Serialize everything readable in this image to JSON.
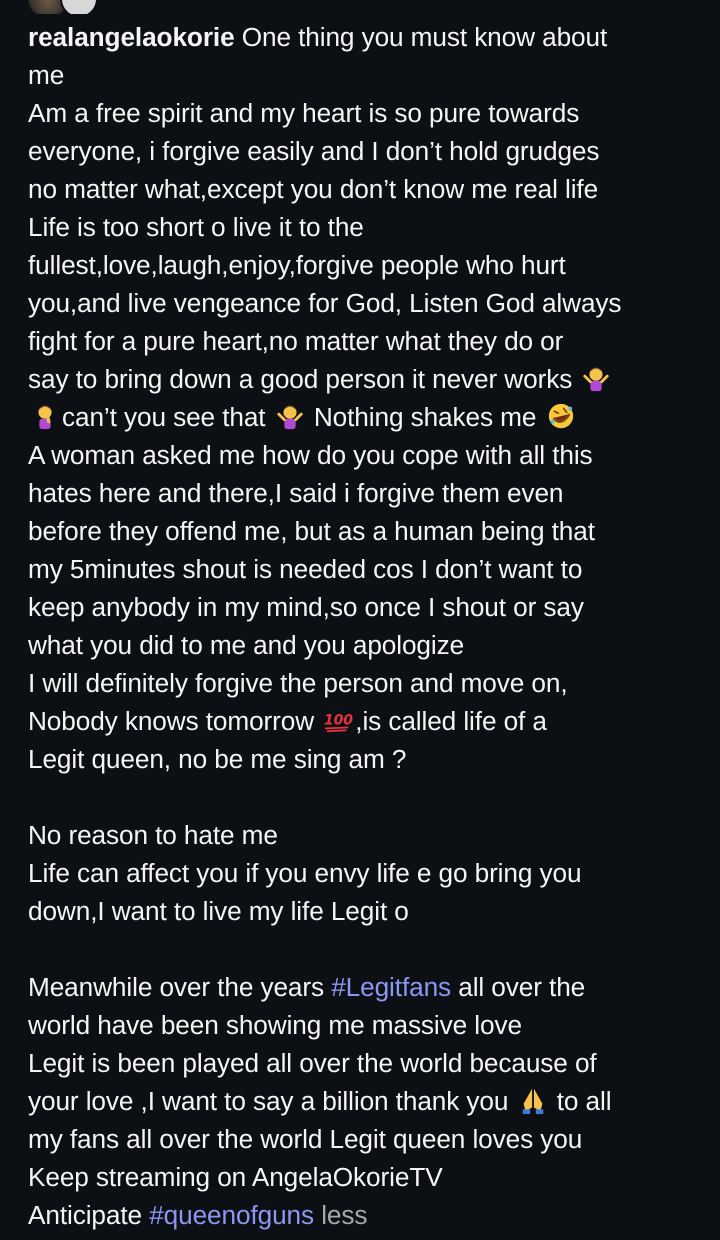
{
  "post": {
    "username": "realangelaokorie",
    "caption_lines": [
      "One thing you must know about",
      "me",
      "Am a free spirit and my heart is so pure towards",
      "everyone, i forgive easily and I don’t hold grudges",
      "no matter what,except you don’t know me real life",
      "Life is too short o live it to the",
      "fullest,love,laugh,enjoy,forgive people who hurt",
      "you,and live vengeance for God, Listen God always",
      "fight for a pure heart,no matter what they do or",
      "say to bring down a good person it never works",
      "can’t you see that",
      "Nothing shakes me",
      "A woman asked me how do you cope with all this",
      "hates here and there,I said i forgive them even",
      "before they offend me, but as a human being that",
      "my 5minutes shout is needed cos I don’t want to",
      "keep anybody in my mind,so once I shout or say",
      "what you did to me and you apologize",
      "I will definitely forgive the person and move on,",
      "Nobody knows tomorrow",
      ",is called life of a",
      "Legit queen, no be me sing am ?",
      "No reason to hate me",
      "Life can affect you if you envy life e go bring you",
      "down,I want to live my life Legit o",
      "Meanwhile over the years",
      "all over the",
      "world have been showing me massive love",
      "Legit is been played all over the world because of",
      "your love ,I want to say a billion thank you",
      "to all",
      "my fans all over the world Legit queen loves you",
      "Keep streaming on AngelaOkorieTV",
      "Anticipate"
    ],
    "hashtags": [
      "#Legitfans",
      "#queenofguns"
    ],
    "less_label": "less",
    "emoji_icons": [
      "person-shrugging-emoji",
      "person-facepalming-emoji",
      "rolling-on-floor-laughing-emoji",
      "hundred-points-emoji",
      "folded-hands-emoji"
    ]
  }
}
